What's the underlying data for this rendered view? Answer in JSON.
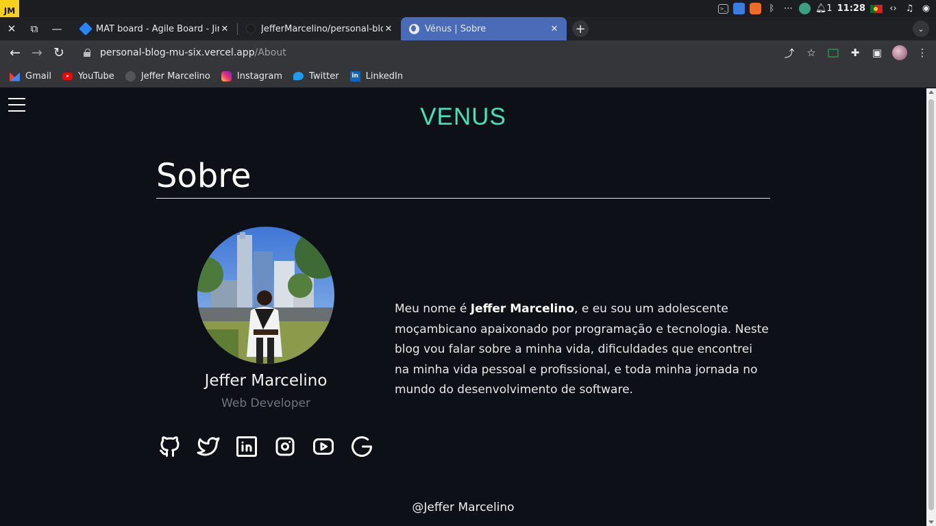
{
  "os_bar": {
    "logo_text": "JM",
    "notification_count": "1",
    "time": "11:28"
  },
  "window_controls": {
    "close": "✕",
    "restore": "⧉",
    "minimize": "—"
  },
  "tabs": [
    {
      "title": "MAT board - Agile Board - Jira",
      "icon": "jira-icon",
      "active": false
    },
    {
      "title": "JefferMarcelino/personal-blog",
      "icon": "github-icon",
      "active": false
    },
    {
      "title": "Vénus | Sobre",
      "icon": "globe-icon",
      "active": true
    }
  ],
  "tab_close_glyph": "✕",
  "new_tab_glyph": "+",
  "tab_list_glyph": "⌄",
  "toolbar": {
    "back": "←",
    "forward": "→",
    "reload": "↻",
    "url_host": "personal-blog-mu-six.vercel.app",
    "url_path": "/About",
    "share": "⤴",
    "bookmark_star": "☆",
    "extensions": "✚",
    "side_panel": "▣",
    "menu": "⋮"
  },
  "bookmarks": [
    {
      "label": "Gmail",
      "icon": "gmail-icon"
    },
    {
      "label": "YouTube",
      "icon": "youtube-icon"
    },
    {
      "label": "Jeffer Marcelino",
      "icon": "github-icon"
    },
    {
      "label": "Instagram",
      "icon": "instagram-icon"
    },
    {
      "label": "Twitter",
      "icon": "twitter-icon"
    },
    {
      "label": "LinkedIn",
      "icon": "linkedin-icon"
    }
  ],
  "page": {
    "brand": "VENUS",
    "heading": "Sobre",
    "profile": {
      "name": "Jeffer Marcelino",
      "role": "Web Developer"
    },
    "bio": {
      "before": "Meu nome é ",
      "name": "Jeffer Marcelino",
      "after": ", e eu sou um adolescente moçambicano apaixonado por programação e tecnologia. Neste blog vou falar sobre a minha vida, dificuldades que encontrei na minha vida pessoal e profissional, e toda minha jornada no mundo do desenvolvimento de software."
    },
    "socials": [
      "github-icon",
      "twitter-icon",
      "linkedin-icon",
      "instagram-icon",
      "youtube-icon",
      "google-icon"
    ],
    "footer": "@Jeffer Marcelino"
  },
  "colors": {
    "page_background": "#0d1117",
    "brand_accent": "#3ee8b5",
    "active_tab": "#4a6bb8",
    "muted_text": "#6e7681"
  }
}
